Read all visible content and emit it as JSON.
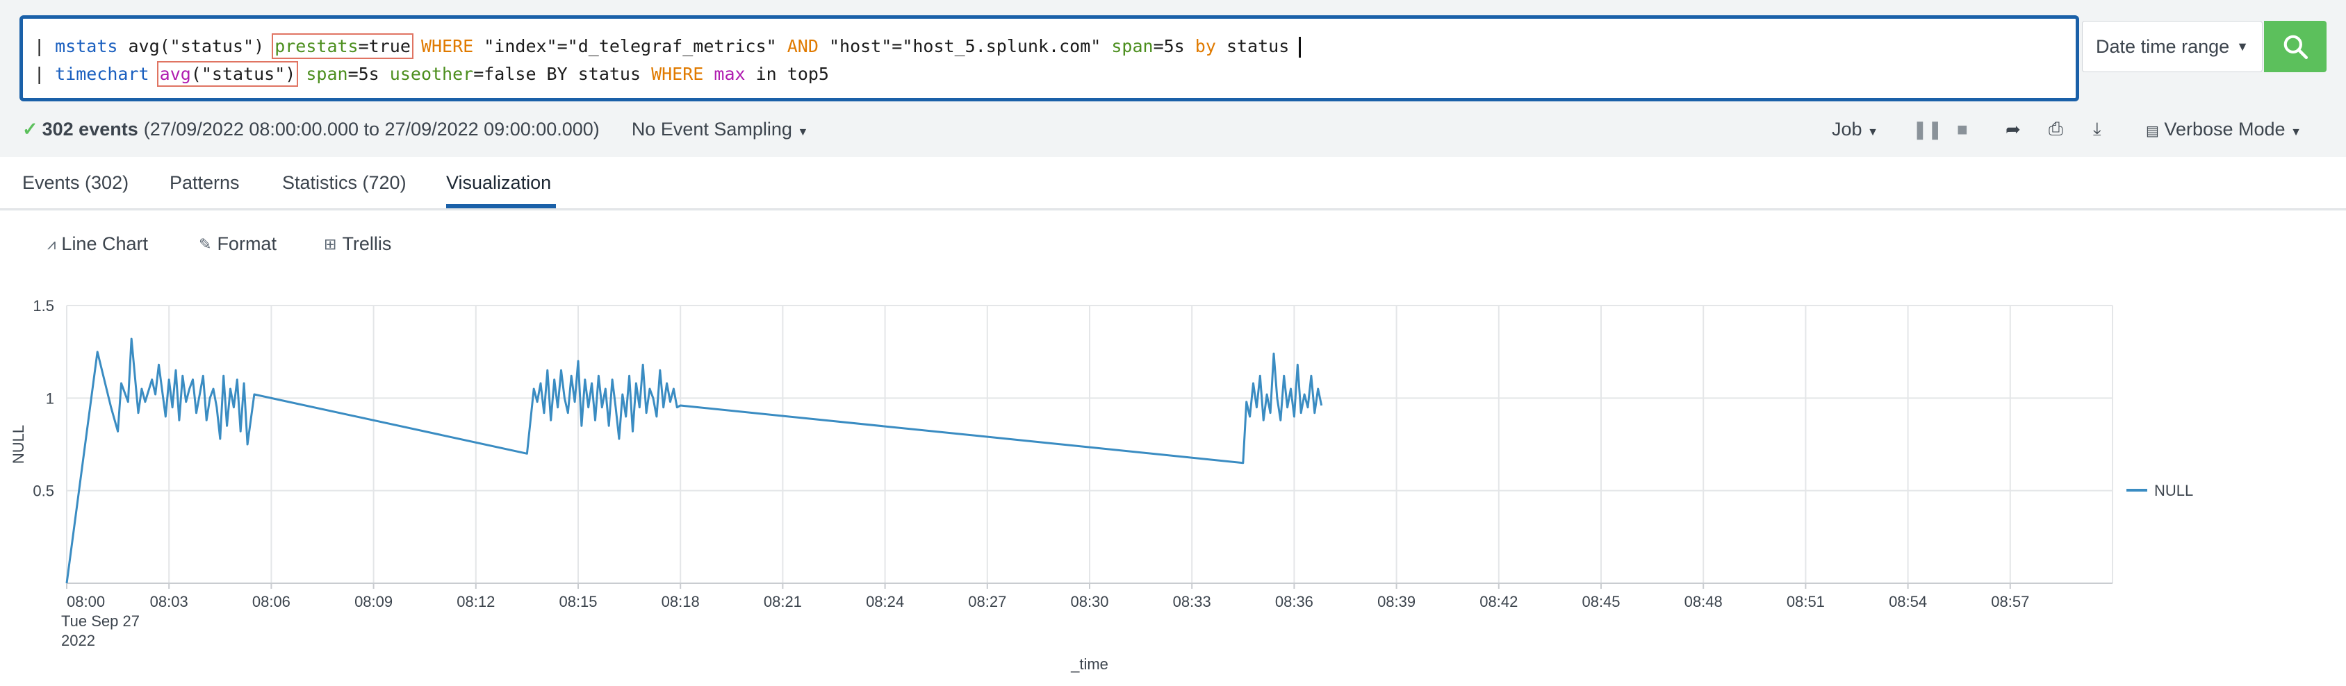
{
  "search": {
    "line1": {
      "pipe": "| ",
      "cmd": "mstats",
      "func": " avg(\"status\") ",
      "prestats_key": "prestats",
      "prestats_val": "=true",
      "where": " WHERE",
      "index_clause": " \"index\"=\"d_telegraf_metrics\"",
      "and": " AND",
      "host_clause": " \"host\"=\"host_5.splunk.com\"",
      "span_key": " span",
      "span_val": "=5s",
      "by": " by",
      "field": " status"
    },
    "line2": {
      "pipe": "| ",
      "cmd": "timechart",
      "space": " ",
      "avg_func": "avg",
      "avg_arg": "(\"status\")",
      "span_key": " span",
      "span_val": "=5s",
      "useother_key": " useother",
      "useother_val": "=false BY status",
      "where": " WHERE",
      "max": " max",
      "tail": " in top5"
    }
  },
  "date_range_label": "Date time range",
  "status": {
    "events": "302 events",
    "range": "(27/09/2022 08:00:00.000 to 27/09/2022 09:00:00.000)",
    "sampling": "No Event Sampling",
    "job": "Job",
    "mode": "Verbose Mode"
  },
  "tabs": [
    "Events (302)",
    "Patterns",
    "Statistics (720)",
    "Visualization"
  ],
  "chart_tools": {
    "line_chart": "Line Chart",
    "format": "Format",
    "trellis": "Trellis"
  },
  "colors": {
    "series": "#3a8cc2",
    "accent": "#1a60a8",
    "search_button": "#5cc05c"
  },
  "chart_data": {
    "type": "line",
    "xlabel": "_time",
    "ylabel": "NULL",
    "ylim": [
      0,
      1.5
    ],
    "yticks": [
      "0.5",
      "1",
      "1.5"
    ],
    "xticks": [
      "08:00",
      "08:03",
      "08:06",
      "08:09",
      "08:12",
      "08:15",
      "08:18",
      "08:21",
      "08:24",
      "08:27",
      "08:30",
      "08:33",
      "08:36",
      "08:39",
      "08:42",
      "08:45",
      "08:48",
      "08:51",
      "08:54",
      "08:57"
    ],
    "xtick_date_line1": "Tue Sep 27",
    "xtick_date_line2": "2022",
    "legend": "NULL",
    "legend_position": "right",
    "grid": true,
    "series": [
      {
        "name": "NULL",
        "x_minutes": [
          0,
          0.9,
          1.3,
          1.5,
          1.6,
          1.8,
          1.9,
          2.0,
          2.1,
          2.2,
          2.3,
          2.5,
          2.6,
          2.7,
          2.9,
          3.0,
          3.1,
          3.2,
          3.3,
          3.4,
          3.5,
          3.6,
          3.7,
          3.8,
          4.0,
          4.1,
          4.2,
          4.3,
          4.4,
          4.5,
          4.6,
          4.7,
          4.8,
          4.9,
          5.0,
          5.1,
          5.2,
          5.3,
          5.5,
          13.5,
          13.7,
          13.8,
          13.9,
          14.0,
          14.1,
          14.2,
          14.3,
          14.4,
          14.5,
          14.6,
          14.7,
          14.8,
          14.9,
          15.0,
          15.1,
          15.2,
          15.3,
          15.4,
          15.5,
          15.6,
          15.7,
          15.8,
          15.9,
          16.0,
          16.1,
          16.2,
          16.3,
          16.4,
          16.5,
          16.6,
          16.7,
          16.8,
          16.9,
          17.0,
          17.1,
          17.2,
          17.3,
          17.4,
          17.5,
          17.6,
          17.7,
          17.8,
          17.9,
          18.0,
          34.5,
          34.6,
          34.7,
          34.8,
          34.9,
          35.0,
          35.1,
          35.2,
          35.3,
          35.4,
          35.5,
          35.6,
          35.7,
          35.8,
          35.9,
          36.0,
          36.1,
          36.2,
          36.3,
          36.4,
          36.5,
          36.6,
          36.7,
          36.8
        ],
        "values": [
          0,
          1.25,
          0.95,
          0.82,
          1.08,
          0.98,
          1.32,
          1.12,
          0.92,
          1.05,
          0.98,
          1.1,
          1.02,
          1.18,
          0.9,
          1.1,
          0.95,
          1.15,
          0.88,
          1.12,
          0.98,
          1.05,
          1.1,
          0.92,
          1.12,
          0.88,
          1.0,
          1.05,
          0.95,
          0.78,
          1.12,
          0.85,
          1.05,
          0.95,
          1.1,
          0.82,
          1.08,
          0.75,
          1.02,
          0.7,
          1.05,
          0.98,
          1.08,
          0.92,
          1.15,
          0.88,
          1.1,
          0.95,
          1.15,
          1.0,
          0.92,
          1.12,
          0.98,
          1.2,
          0.85,
          1.1,
          0.95,
          1.08,
          0.88,
          1.12,
          0.95,
          1.05,
          0.85,
          1.1,
          0.95,
          0.78,
          1.02,
          0.9,
          1.12,
          0.82,
          1.08,
          0.95,
          1.18,
          0.92,
          1.05,
          1.0,
          0.9,
          1.15,
          0.95,
          1.08,
          0.98,
          1.05,
          0.95,
          0.96,
          0.65,
          0.98,
          0.9,
          1.08,
          0.95,
          1.12,
          0.88,
          1.02,
          0.92,
          1.24,
          1.0,
          0.88,
          1.12,
          0.95,
          1.05,
          0.9,
          1.18,
          0.92,
          1.02,
          0.95,
          1.12,
          0.92,
          1.05,
          0.96
        ]
      }
    ]
  }
}
